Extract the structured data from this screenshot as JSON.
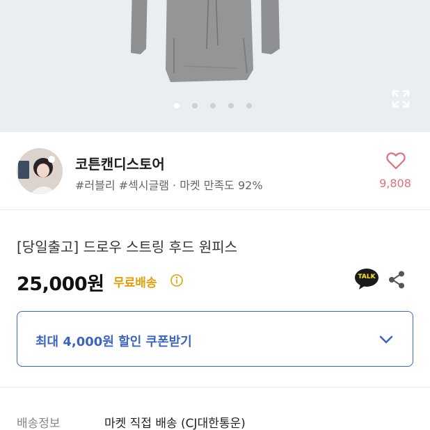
{
  "gallery": {
    "slide_count": 5,
    "active_index": 0
  },
  "shop": {
    "name": "코튼캔디스토어",
    "tags": "#러블리 #섹시글램 · 마켓 만족도 92%",
    "like_count": "9,808"
  },
  "product": {
    "title": "[당일출고] 드로우 스트링 후드 원피스",
    "price": "25,000원",
    "shipping_badge": "무료배송"
  },
  "actions": {
    "talk_label": "TALK"
  },
  "coupon": {
    "label": "최대 4,000원 할인 쿠폰받기"
  },
  "delivery": {
    "label": "배송정보",
    "value": "마켓 직접 배송 (CJ대한통운)"
  },
  "colors": {
    "brand_blue": "#3b63c4",
    "shipping_yellow": "#e3a008",
    "like_pink": "#e06f7c"
  }
}
